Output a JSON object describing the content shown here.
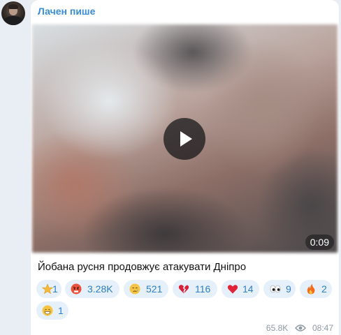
{
  "channel": {
    "sender_name": "Лачен пише"
  },
  "video": {
    "duration": "0:09"
  },
  "caption": "Йобана русня продовжує атакувати Дніпро",
  "reactions": [
    {
      "icon": "star-icon",
      "count": "1"
    },
    {
      "icon": "angry-face-icon",
      "count": "3.28K"
    },
    {
      "icon": "crying-face-icon",
      "count": "521"
    },
    {
      "icon": "broken-heart-icon",
      "count": "116"
    },
    {
      "icon": "red-heart-icon",
      "count": "14"
    },
    {
      "icon": "eyes-icon",
      "count": "9"
    },
    {
      "icon": "fire-icon",
      "count": "2"
    },
    {
      "icon": "grinning-face-icon",
      "count": "1"
    }
  ],
  "meta": {
    "views": "65.8K",
    "time": "08:47"
  },
  "colors": {
    "accent": "#3a8dd6",
    "reaction_bg": "#e6f0fa",
    "reaction_text": "#2d7ec7"
  }
}
